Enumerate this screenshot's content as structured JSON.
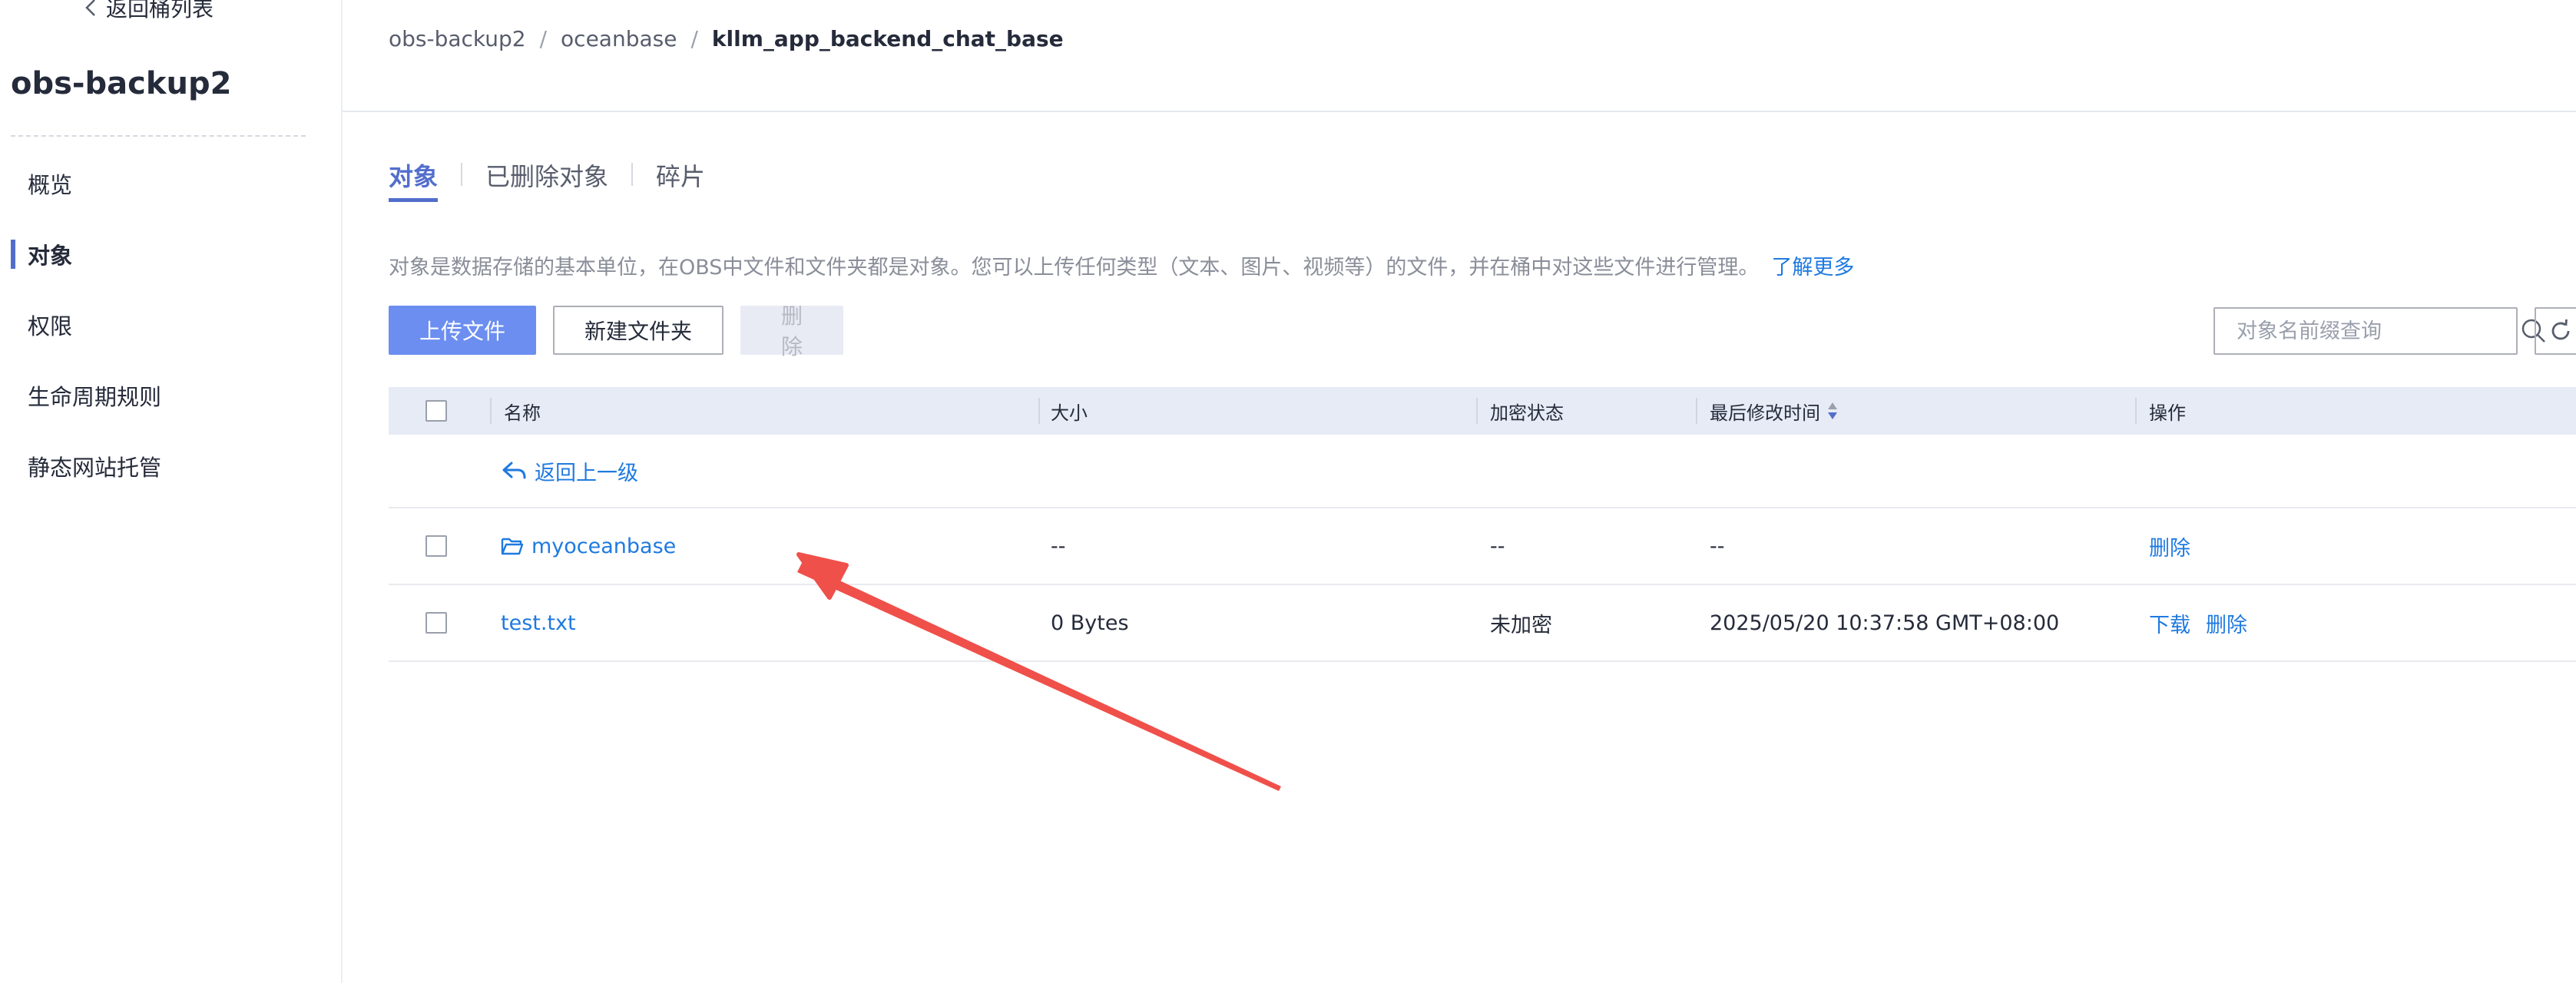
{
  "sidebar": {
    "back_label": "返回桶列表",
    "bucket_name": "obs-backup2",
    "items": [
      {
        "label": "概览",
        "active": false
      },
      {
        "label": "对象",
        "active": true
      },
      {
        "label": "权限",
        "active": false
      },
      {
        "label": "生命周期规则",
        "active": false
      },
      {
        "label": "静态网站托管",
        "active": false
      }
    ]
  },
  "breadcrumb": [
    "obs-backup2",
    "oceanbase",
    "kllm_app_backend_chat_base"
  ],
  "tabs": [
    {
      "label": "对象",
      "active": true
    },
    {
      "label": "已删除对象",
      "active": false
    },
    {
      "label": "碎片",
      "active": false
    }
  ],
  "description": {
    "text": "对象是数据存储的基本单位，在OBS中文件和文件夹都是对象。您可以上传任何类型（文本、图片、视频等）的文件，并在桶中对这些文件进行管理。",
    "link": "了解更多"
  },
  "toolbar": {
    "upload_label": "上传文件",
    "new_folder_label": "新建文件夹",
    "delete_label": "删除"
  },
  "search": {
    "placeholder": "对象名前缀查询",
    "value": ""
  },
  "table": {
    "headers": {
      "name": "名称",
      "size": "大小",
      "encryption": "加密状态",
      "modified": "最后修改时间",
      "actions": "操作"
    },
    "back_label": "返回上一级",
    "rows": [
      {
        "type": "folder",
        "name": "myoceanbase",
        "size": "--",
        "encryption": "--",
        "modified": "--",
        "actions": [
          "删除"
        ]
      },
      {
        "type": "file",
        "name": "test.txt",
        "size": "0 Bytes",
        "encryption": "未加密",
        "modified": "2025/05/20 10:37:58 GMT+08:00",
        "actions": [
          "下载",
          "删除"
        ]
      }
    ]
  },
  "colors": {
    "accent": "#526ecc",
    "link": "#1f7ae0",
    "primary_button": "#6b8ef0",
    "table_header_bg": "#e6ebf5",
    "annotation_arrow": "#f0504a"
  }
}
